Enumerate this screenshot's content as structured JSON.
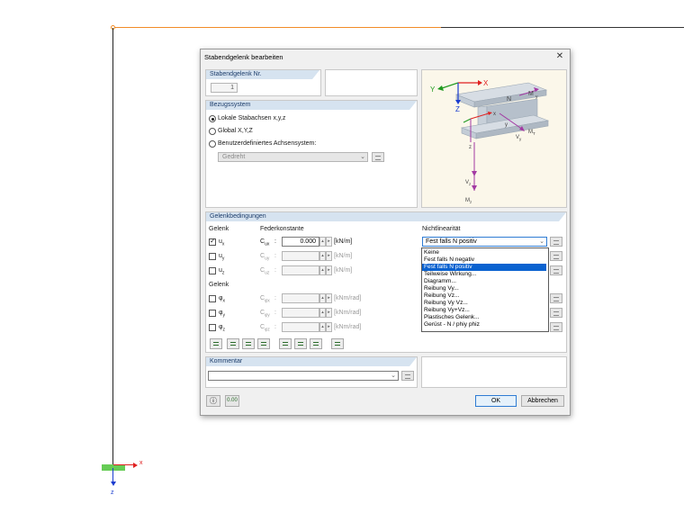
{
  "dialog": {
    "title": "Stabendgelenk bearbeiten",
    "close_glyph": "✕",
    "hinge_no": {
      "header": "Stabendgelenk Nr.",
      "value": "1"
    },
    "reference": {
      "header": "Bezugssystem",
      "options": [
        "Lokale Stabachsen x,y,z",
        "Global X,Y,Z",
        "Benutzerdefiniertes Achsensystem:"
      ],
      "selected_index": 0,
      "user_system_value": "Gedreht"
    },
    "diagram": {
      "labels": {
        "x": "X",
        "y": "Y",
        "z_global": "Z",
        "n": "N",
        "my_top": "M",
        "my_top_sub": "y",
        "x_local": "x",
        "y_local": "y",
        "vy": "V",
        "vy_sub": "y",
        "z_local": "z",
        "vz": "V",
        "vz_sub": "z",
        "mz": "M",
        "mz_sub": "z",
        "mx": "M",
        "mx_sub": "T"
      }
    },
    "conditions": {
      "header": "Gelenkbedingungen",
      "col_gelenk": "Gelenk",
      "col_feder": "Federkonstante",
      "col_nonlin": "Nichtlinearität",
      "rows_translation": [
        {
          "dof": "u",
          "sub": "x",
          "spring": "C",
          "spring_sub": "ux",
          "value": "0.000",
          "unit": "[kN/m]",
          "checked": true
        },
        {
          "dof": "u",
          "sub": "y",
          "spring": "C",
          "spring_sub": "uy",
          "value": "",
          "unit": "[kN/m]",
          "checked": false
        },
        {
          "dof": "u",
          "sub": "z",
          "spring": "C",
          "spring_sub": "uz",
          "value": "",
          "unit": "[kN/m]",
          "checked": false
        }
      ],
      "col_gelenk2": "Gelenk",
      "rows_rotation": [
        {
          "dof": "φ",
          "sub": "x",
          "spring": "C",
          "spring_sub": "φx",
          "value": "",
          "unit": "[kNm/rad]",
          "checked": false
        },
        {
          "dof": "φ",
          "sub": "y",
          "spring": "C",
          "spring_sub": "φy",
          "value": "",
          "unit": "[kNm/rad]",
          "checked": false
        },
        {
          "dof": "φ",
          "sub": "z",
          "spring": "C",
          "spring_sub": "φz",
          "value": "",
          "unit": "[kNm/rad]",
          "checked": false
        }
      ],
      "colon": ":",
      "nonlinearity_selected": "Fest falls N positiv",
      "nonlinearity_options": [
        "Keine",
        "Fest falls N negativ",
        "Fest falls N positiv",
        "Teilweise Wirkung...",
        "Diagramm...",
        "Reibung Vy...",
        "Reibung Vz...",
        "Reibung Vy Vz...",
        "Reibung Vy+Vz...",
        "Plastisches Gelenk...",
        "Gerüst - N / phiy phiz"
      ],
      "nonlinearity_highlight_index": 2,
      "toolbar_icons": [
        "hinge-all-icon",
        "hinge-vy-icon",
        "hinge-vz-icon",
        "hinge-vyvz-icon",
        "hinge-my-icon",
        "hinge-mz-icon",
        "hinge-mymz-icon",
        "hinge-n-icon"
      ]
    },
    "comment": {
      "header": "Kommentar",
      "value": ""
    },
    "footer": {
      "ok": "OK",
      "cancel": "Abbrechen"
    }
  },
  "background": {
    "axis_x_label": "x",
    "axis_z_label": "z",
    "colors": {
      "member_top": "#f28c28",
      "axis_x": "#e02020",
      "axis_z": "#1a3ccf",
      "support": "#66cc55"
    }
  }
}
